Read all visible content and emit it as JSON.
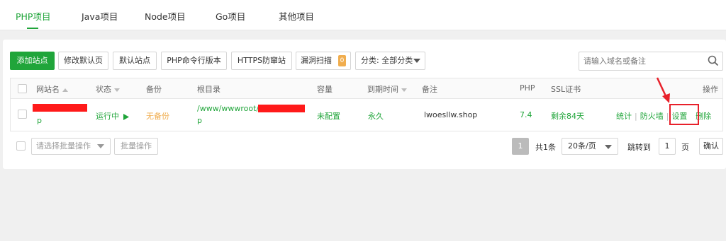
{
  "tabs": [
    "PHP项目",
    "Java项目",
    "Node项目",
    "Go项目",
    "其他项目"
  ],
  "toolbar": {
    "add_site": "添加站点",
    "edit_default_page": "修改默认页",
    "default_site": "默认站点",
    "php_cli_version": "PHP命令行版本",
    "https_protection": "HTTPS防窜站",
    "vuln_scan": "漏洞扫描",
    "vuln_count": "0",
    "category": "分类: 全部分类"
  },
  "search": {
    "placeholder": "请输入域名或备注"
  },
  "table": {
    "headers": {
      "site_name": "网站名",
      "status": "状态",
      "backup": "备份",
      "root_dir": "根目录",
      "quota": "容量",
      "expire": "到期时间",
      "remark": "备注",
      "php": "PHP",
      "ssl": "SSL证书",
      "actions": "操作"
    },
    "row": {
      "site_name_suffix": "p",
      "status": "运行中",
      "status_icon": "play-icon",
      "backup": "无备份",
      "root_dir_prefix": "/www/wwwroot/",
      "root_dir_suffix": "p",
      "quota": "未配置",
      "expire": "永久",
      "remark": "lwoesllw.shop",
      "php": "7.4",
      "ssl": "剩余84天",
      "action_stats": "统计",
      "action_firewall": "防火墙",
      "action_settings": "设置",
      "action_delete": "删除"
    }
  },
  "footer": {
    "batch_placeholder": "请选择批量操作",
    "batch_button": "批量操作",
    "current_page": "1",
    "total": "共1条",
    "page_size": "20条/页",
    "goto_label": "跳转到",
    "goto_value": "1",
    "page_unit": "页",
    "confirm": "确认"
  },
  "colors": {
    "accent": "#20a53a",
    "warning": "#f0ad4e",
    "highlight": "#e8202a"
  }
}
